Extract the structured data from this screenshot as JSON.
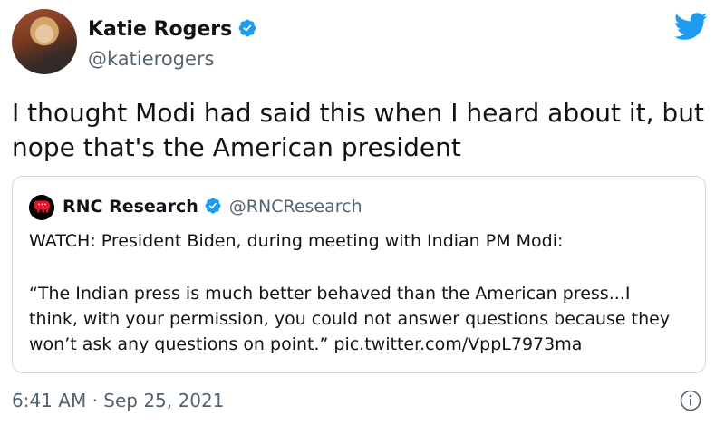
{
  "author": {
    "name": "Katie Rogers",
    "handle": "@katierogers",
    "verified": true
  },
  "tweet": {
    "text_lines": [
      "I thought Modi had said this when I heard about it, but",
      "nope that's the American president"
    ],
    "timestamp": "6:41 AM · Sep 25, 2021"
  },
  "quoted_tweet": {
    "name": "RNC Research",
    "handle": "@RNCResearch",
    "verified": true,
    "line1": "WATCH: President Biden, during meeting with Indian PM Modi:",
    "body_lines": [
      "“The Indian press is much better behaved than the American press...I",
      "think, with your permission, you could not answer questions because they",
      "won’t ask any questions on point.” pic.twitter.com/VppL7973ma"
    ]
  },
  "icons": {
    "logo": "twitter-bird-icon",
    "verified": "verified-badge-icon",
    "info": "info-icon",
    "quoted_avatar": "republican-elephant-icon"
  },
  "colors": {
    "twitter_blue": "#1d9bf0",
    "text_primary": "#0f1419",
    "text_secondary": "#536471",
    "border": "#cfd9de",
    "rnc_red": "#e0162b"
  }
}
